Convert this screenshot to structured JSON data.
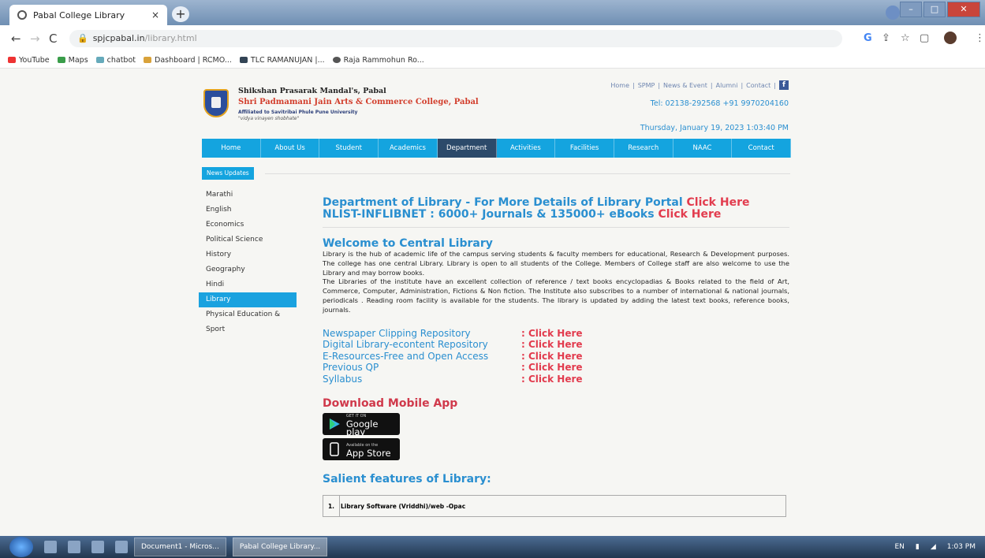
{
  "browser": {
    "tab_title": "Pabal College Library",
    "tab_close": "×",
    "new_tab": "+",
    "url_host": "spjcpabal.in",
    "url_path": "/library.html",
    "bookmarks": [
      "YouTube",
      "Maps",
      "chatbot",
      "Dashboard | RCMO...",
      "TLC RAMANUJAN |...",
      "Raja Rammohun Ro..."
    ]
  },
  "header": {
    "line1": "Shikshan Prasarak Mandal's, Pabal",
    "line2": "Shri Padmamani Jain Arts & Commerce College, Pabal",
    "line3": "Affiliated to Savitribai Phule Pune University",
    "line4": "\"vidya vinayen shobhate\"",
    "top_links": [
      "Home",
      "SPMP",
      "News & Event",
      "Alumni",
      "Contact"
    ],
    "phone": "Tel: 02138-292568 +91 9970204160",
    "datetime": "Thursday, January 19, 2023 1:03:40 PM"
  },
  "menu": [
    "Home",
    "About Us",
    "Student",
    "Academics",
    "Department",
    "Activities",
    "Facilities",
    "Research",
    "NAAC",
    "Contact"
  ],
  "news_updates": "News Updates",
  "sidebar": [
    "Marathi",
    "English",
    "Economics",
    "Political Science",
    "History",
    "Geography",
    "Hindi",
    "Library",
    "Physical Education &",
    "Sport"
  ],
  "main": {
    "dept_text": "Department of Library - For More Details of Library Portal",
    "dept_click": "Click Here",
    "nlist_text": "NLIST-INFLIBNET : 6000+ Journals & 135000+ eBooks",
    "nlist_click": "Click Here",
    "welcome_title": "Welcome to Central Library",
    "paragraph1": "Library is the hub of academic life of the campus serving students & faculty members for educational, Research & Development purposes. The college has one central Library. Library is open to all students of the College. Members of College staff are also welcome to use the Library and may borrow books.",
    "paragraph2": "The Libraries of the institute have an excellent collection of reference / text books encyclopadias & Books related to the field of Art, Commerce, Computer, Administration, Fictions & Non fiction. The Institute also subscribes to a number of international & national journals, periodicals . Reading room facility is available for the students. The library is updated by adding the latest text books, reference books, journals.",
    "links": [
      {
        "label": "Newspaper Clipping Repository",
        "action": ": Click Here"
      },
      {
        "label": "Digital Library-econtent Repository",
        "action": ": Click Here"
      },
      {
        "label": "E-Resources-Free and Open Access",
        "action": ": Click Here"
      },
      {
        "label": "Previous QP",
        "action": ": Click Here"
      },
      {
        "label": "Syllabus",
        "action": ": Click Here"
      }
    ],
    "download_title": "Download Mobile App",
    "google_play_small": "GET IT ON",
    "google_play": "Google play",
    "app_store_small": "Available on the",
    "app_store": "App Store",
    "salient_title": "Salient features of Library:",
    "features": [
      {
        "num": "1.",
        "text": "Library Software (Vriddhi)/web -Opac"
      }
    ]
  },
  "taskbar": {
    "tasks": [
      "Document1 - Micros...",
      "Pabal College Library..."
    ],
    "lang": "EN",
    "time": "1:03 PM"
  }
}
